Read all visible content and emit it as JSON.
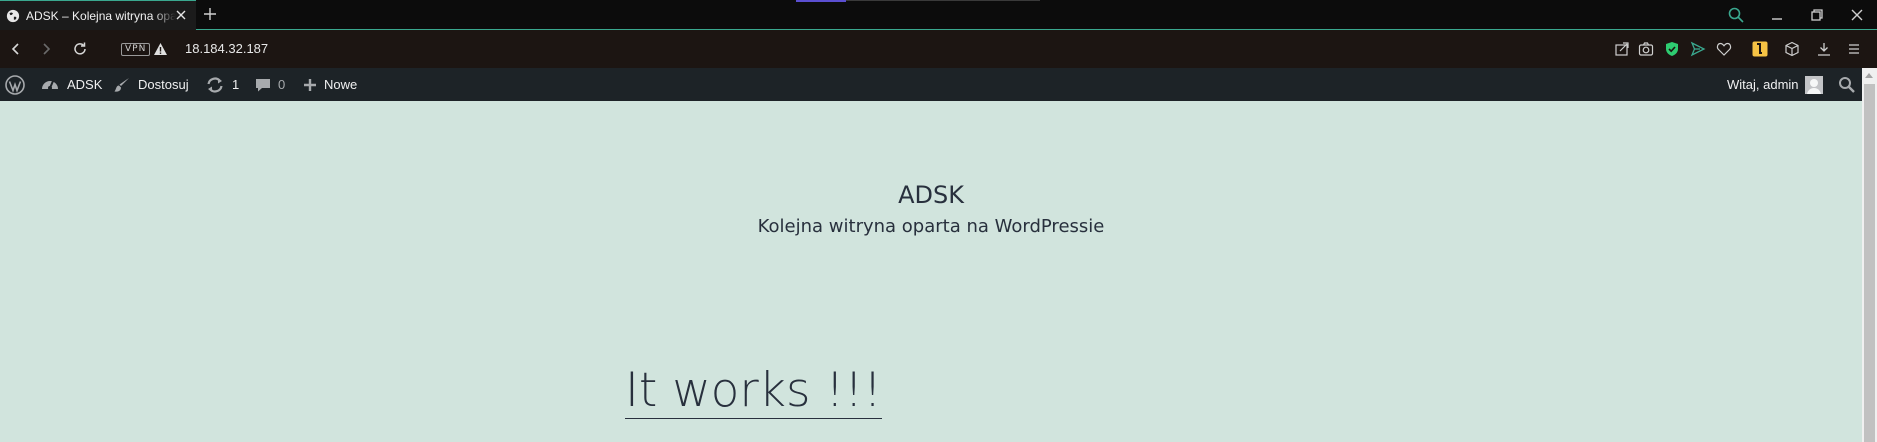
{
  "browser": {
    "tab": {
      "title": "ADSK – Kolejna witryna oparta na WordPressie",
      "icon": "globe-icon"
    },
    "address": {
      "vpn_label": "VPN",
      "url": "18.184.32.187"
    },
    "accent_color": "#3aa88f"
  },
  "adminbar": {
    "site_name": "ADSK",
    "customize_label": "Dostosuj",
    "updates_count": "1",
    "comments_count": "0",
    "new_label": "Nowe",
    "greeting": "Witaj, admin"
  },
  "site": {
    "title": "ADSK",
    "description": "Kolejna witryna oparta na WordPressie",
    "background": "#d1e4dd"
  },
  "post": {
    "title": "It works !!!"
  }
}
